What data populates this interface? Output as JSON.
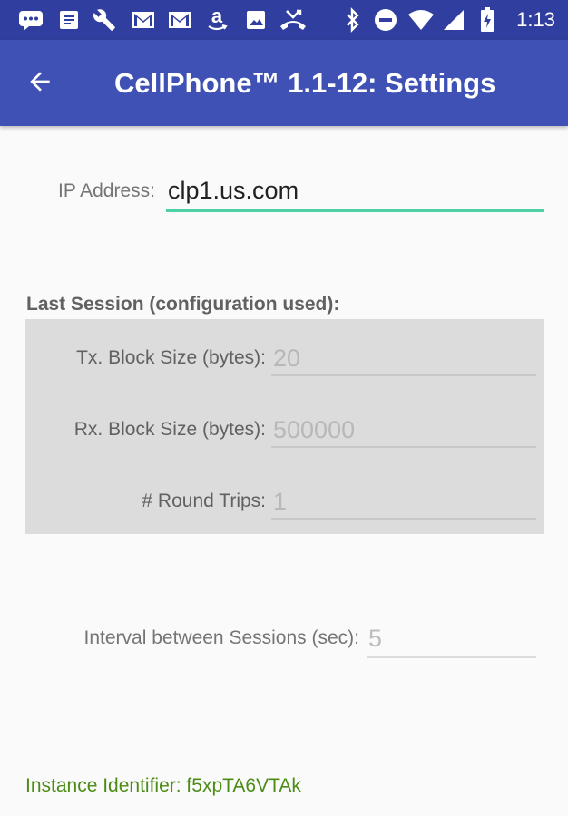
{
  "status_bar": {
    "time": "1:13",
    "left_icons": [
      "message-icon",
      "notes-icon",
      "wrench-icon",
      "gmail-icon",
      "gmail-icon",
      "amazon-icon",
      "image-icon",
      "missed-call-icon"
    ],
    "right_icons": [
      "bluetooth-icon",
      "do-not-disturb-icon",
      "wifi-icon",
      "signal-icon",
      "battery-charging-icon"
    ]
  },
  "app_bar": {
    "title": "CellPhone™ 1.1-12: Settings",
    "back_icon": "arrow-left-icon"
  },
  "ip_address": {
    "label": "IP Address:",
    "value": "clp1.us.com"
  },
  "last_session": {
    "heading": "Last Session (configuration used):",
    "tx_block_size": {
      "label": "Tx. Block Size (bytes):",
      "value": "20"
    },
    "rx_block_size": {
      "label": "Rx. Block Size (bytes):",
      "value": "500000"
    },
    "round_trips": {
      "label": "# Round Trips:",
      "value": "1"
    }
  },
  "interval": {
    "label": "Interval between Sessions (sec):",
    "value": "5"
  },
  "instance_identifier": "Instance Identifier: f5xpTA6VTAk",
  "colors": {
    "status_bar": "#303f9f",
    "app_bar": "#3f51b5",
    "accent": "#4dd0a5",
    "instance_text": "#4c8c16",
    "session_box": "#dcdcdc"
  }
}
